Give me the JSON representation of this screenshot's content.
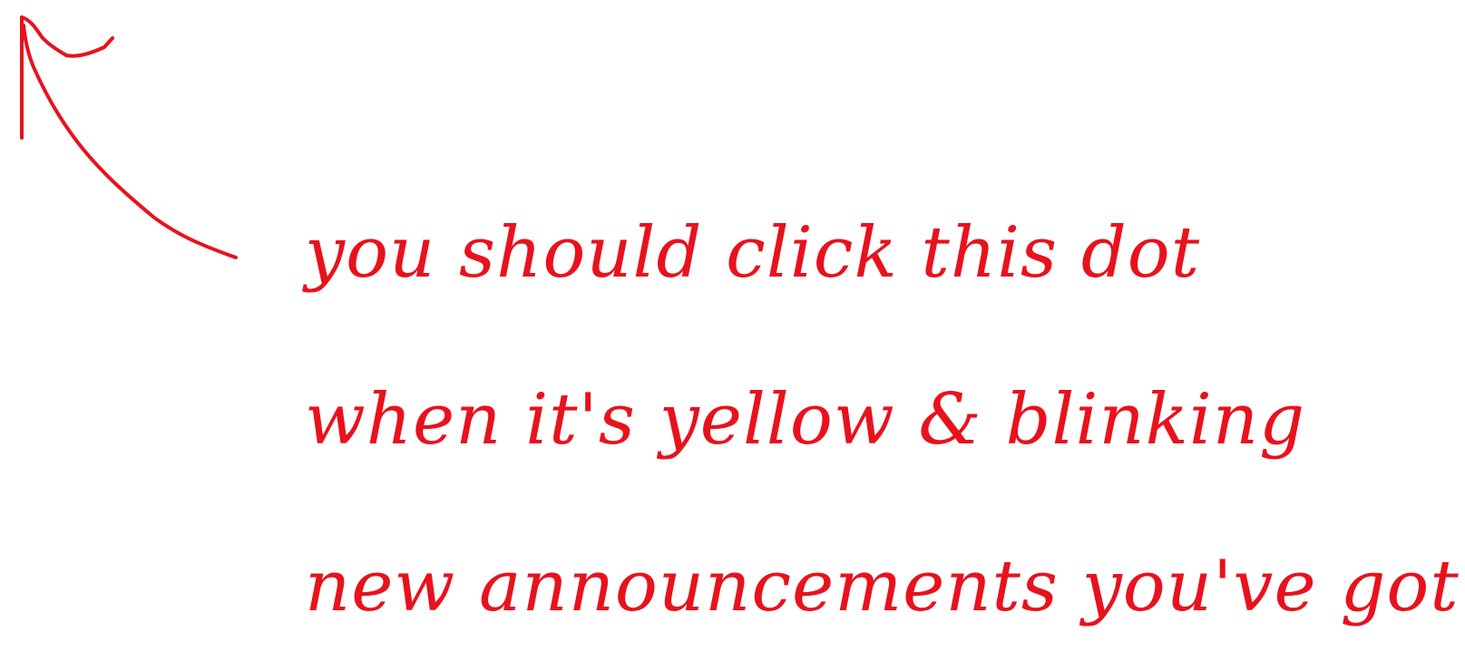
{
  "annotation": {
    "lines": [
      "you should click this dot",
      "when it's yellow & blinking",
      "new announcements you've got"
    ],
    "color": "#e8121d"
  },
  "icons": {
    "pointer": "curved-arrow-up-left-icon"
  }
}
